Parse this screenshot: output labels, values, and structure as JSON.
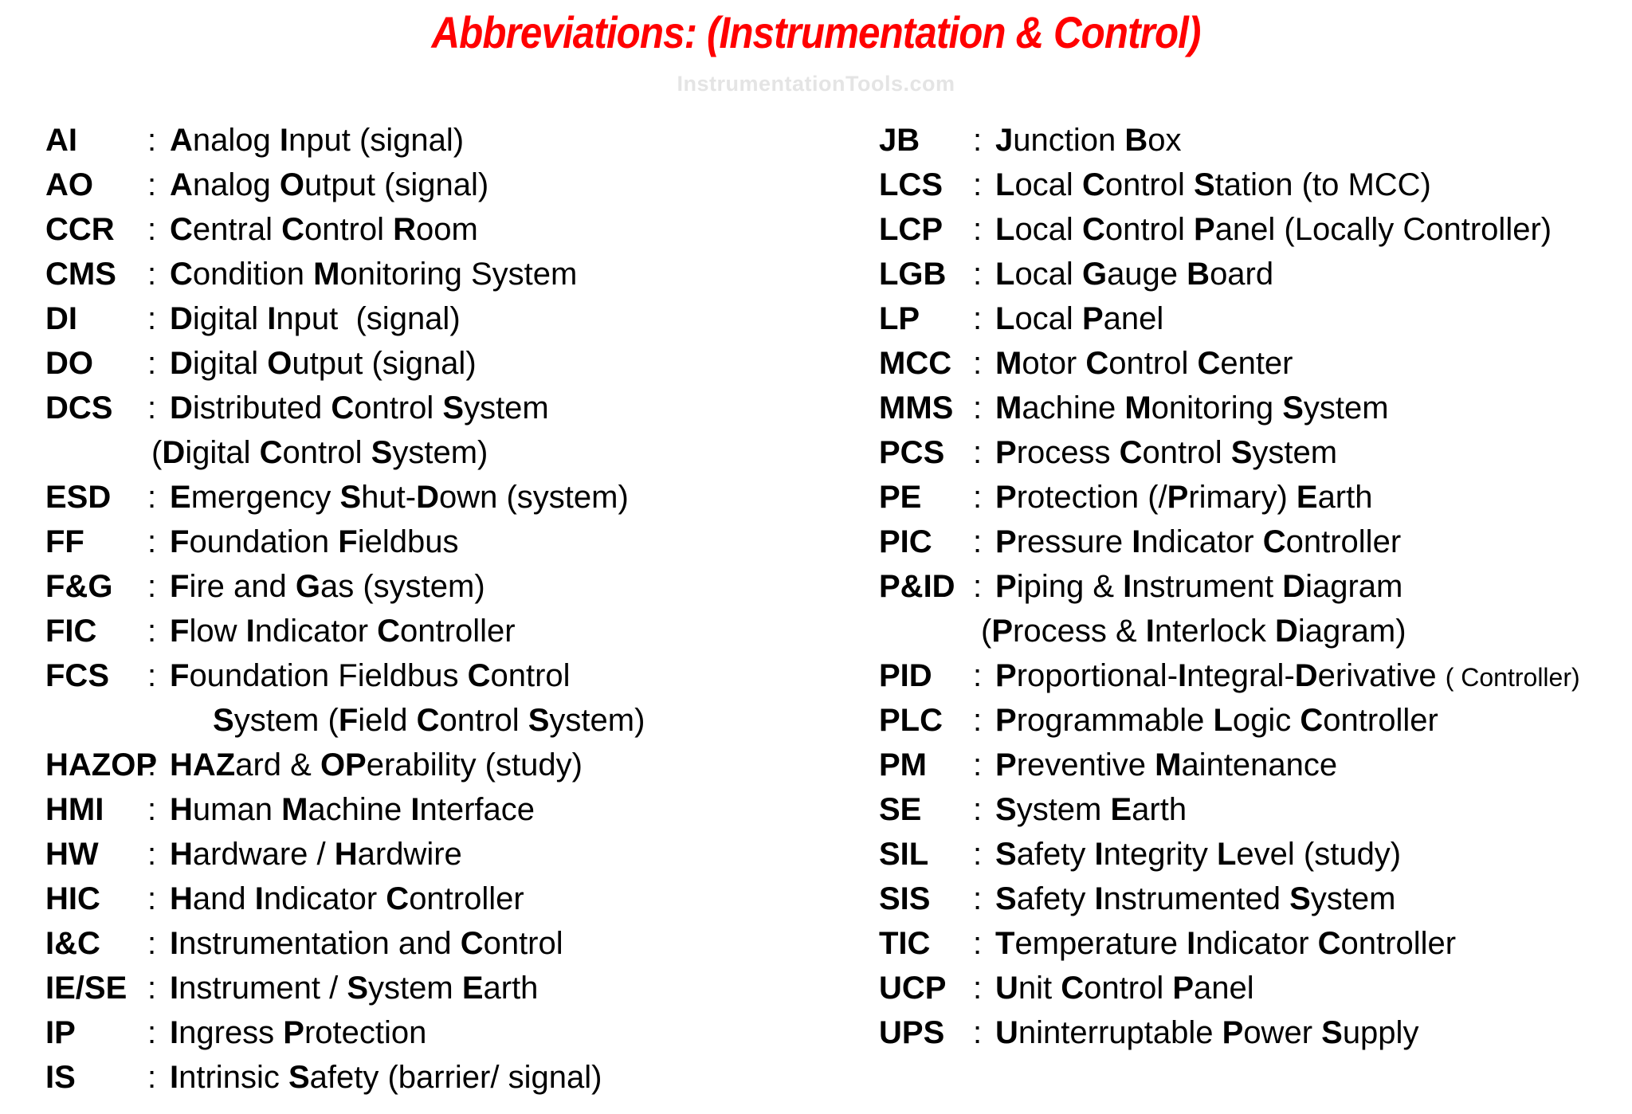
{
  "title": "Abbreviations:  (Instrumentation & Control)",
  "watermark": "InstrumentationTools.com",
  "colors": {
    "title": "#ff0000",
    "watermark": "#e4e4e4",
    "text": "#000000"
  },
  "left": [
    {
      "abbr": "AI",
      "def": [
        [
          "A",
          1
        ],
        [
          "nalog ",
          0
        ],
        [
          "I",
          1
        ],
        [
          "nput (signal)",
          0
        ]
      ]
    },
    {
      "abbr": "AO",
      "def": [
        [
          "A",
          1
        ],
        [
          "nalog ",
          0
        ],
        [
          "O",
          1
        ],
        [
          "utput (signal)",
          0
        ]
      ]
    },
    {
      "abbr": "CCR",
      "def": [
        [
          "C",
          1
        ],
        [
          "entral ",
          0
        ],
        [
          "C",
          1
        ],
        [
          "ontrol ",
          0
        ],
        [
          "R",
          1
        ],
        [
          "oom",
          0
        ]
      ]
    },
    {
      "abbr": "CMS",
      "def": [
        [
          "C",
          1
        ],
        [
          "ondition ",
          0
        ],
        [
          "M",
          1
        ],
        [
          "onitoring System",
          0
        ]
      ]
    },
    {
      "abbr": "DI",
      "def": [
        [
          "D",
          1
        ],
        [
          "igital ",
          0
        ],
        [
          "I",
          1
        ],
        [
          "nput  (signal)",
          0
        ]
      ]
    },
    {
      "abbr": "DO",
      "def": [
        [
          "D",
          1
        ],
        [
          "igital ",
          0
        ],
        [
          "O",
          1
        ],
        [
          "utput (signal)",
          0
        ]
      ]
    },
    {
      "abbr": "DCS",
      "def": [
        [
          "D",
          1
        ],
        [
          "istributed ",
          0
        ],
        [
          "C",
          1
        ],
        [
          "ontrol ",
          0
        ],
        [
          "S",
          1
        ],
        [
          "ystem",
          0
        ]
      ]
    },
    {
      "abbr": "",
      "cont": 1,
      "def": [
        [
          "(",
          0
        ],
        [
          "D",
          1
        ],
        [
          "igital ",
          0
        ],
        [
          "C",
          1
        ],
        [
          "ontrol ",
          0
        ],
        [
          "S",
          1
        ],
        [
          "ystem)",
          0
        ]
      ]
    },
    {
      "abbr": "ESD",
      "def": [
        [
          "E",
          1
        ],
        [
          "mergency ",
          0
        ],
        [
          "S",
          1
        ],
        [
          "hut-",
          0
        ],
        [
          "D",
          1
        ],
        [
          "own (system)",
          0
        ]
      ]
    },
    {
      "abbr": "FF",
      "def": [
        [
          "F",
          1
        ],
        [
          "oundation ",
          0
        ],
        [
          "F",
          1
        ],
        [
          "ieldbus",
          0
        ]
      ]
    },
    {
      "abbr": "F&G",
      "def": [
        [
          "F",
          1
        ],
        [
          "ire and ",
          0
        ],
        [
          "G",
          1
        ],
        [
          "as (system)",
          0
        ]
      ]
    },
    {
      "abbr": "FIC",
      "def": [
        [
          "F",
          1
        ],
        [
          "low ",
          0
        ],
        [
          "I",
          1
        ],
        [
          "ndicator ",
          0
        ],
        [
          "C",
          1
        ],
        [
          "ontroller",
          0
        ]
      ]
    },
    {
      "abbr": "FCS",
      "def": [
        [
          "F",
          1
        ],
        [
          "oundation Fieldbus ",
          0
        ],
        [
          "C",
          1
        ],
        [
          "ontrol",
          0
        ]
      ]
    },
    {
      "abbr": "",
      "cont": 2,
      "def": [
        [
          "S",
          1
        ],
        [
          "ystem (",
          0
        ],
        [
          "F",
          1
        ],
        [
          "ield ",
          0
        ],
        [
          "C",
          1
        ],
        [
          "ontrol ",
          0
        ],
        [
          "S",
          1
        ],
        [
          "ystem)",
          0
        ]
      ]
    },
    {
      "abbr": "HAZOP",
      "def": [
        [
          "HAZ",
          1
        ],
        [
          "ard & ",
          0
        ],
        [
          "OP",
          1
        ],
        [
          "erability (study)",
          0
        ]
      ]
    },
    {
      "abbr": "HMI",
      "def": [
        [
          "H",
          1
        ],
        [
          "uman ",
          0
        ],
        [
          "M",
          1
        ],
        [
          "achine ",
          0
        ],
        [
          "I",
          1
        ],
        [
          "nterface",
          0
        ]
      ]
    },
    {
      "abbr": "HW",
      "def": [
        [
          "H",
          1
        ],
        [
          "ardware / ",
          0
        ],
        [
          "H",
          1
        ],
        [
          "ardwire",
          0
        ]
      ]
    },
    {
      "abbr": "HIC",
      "def": [
        [
          "H",
          1
        ],
        [
          "and ",
          0
        ],
        [
          "I",
          1
        ],
        [
          "ndicator ",
          0
        ],
        [
          "C",
          1
        ],
        [
          "ontroller",
          0
        ]
      ]
    },
    {
      "abbr": "I&C",
      "def": [
        [
          "I",
          1
        ],
        [
          "nstrumentation and ",
          0
        ],
        [
          "C",
          1
        ],
        [
          "ontrol",
          0
        ]
      ]
    },
    {
      "abbr": "IE/SE",
      "def": [
        [
          "I",
          1
        ],
        [
          "nstrument / ",
          0
        ],
        [
          "S",
          1
        ],
        [
          "ystem ",
          0
        ],
        [
          "E",
          1
        ],
        [
          "arth",
          0
        ]
      ]
    },
    {
      "abbr": "IP",
      "def": [
        [
          "I",
          1
        ],
        [
          "ngress ",
          0
        ],
        [
          "P",
          1
        ],
        [
          "rotection",
          0
        ]
      ]
    },
    {
      "abbr": "IS",
      "def": [
        [
          "I",
          1
        ],
        [
          "ntrinsic ",
          0
        ],
        [
          "S",
          1
        ],
        [
          "afety (barrier/ signal)",
          0
        ]
      ]
    }
  ],
  "right": [
    {
      "abbr": "JB",
      "def": [
        [
          "J",
          1
        ],
        [
          "unction ",
          0
        ],
        [
          "B",
          1
        ],
        [
          "ox",
          0
        ]
      ]
    },
    {
      "abbr": "LCS",
      "def": [
        [
          "L",
          1
        ],
        [
          "ocal ",
          0
        ],
        [
          "C",
          1
        ],
        [
          "ontrol ",
          0
        ],
        [
          "S",
          1
        ],
        [
          "tation (to MCC)",
          0
        ]
      ]
    },
    {
      "abbr": "LCP",
      "def": [
        [
          "L",
          1
        ],
        [
          "ocal ",
          0
        ],
        [
          "C",
          1
        ],
        [
          "ontrol ",
          0
        ],
        [
          "P",
          1
        ],
        [
          "anel (Locally Controller)",
          0
        ]
      ]
    },
    {
      "abbr": "LGB",
      "def": [
        [
          "L",
          1
        ],
        [
          "ocal ",
          0
        ],
        [
          "G",
          1
        ],
        [
          "auge ",
          0
        ],
        [
          "B",
          1
        ],
        [
          "oard",
          0
        ]
      ]
    },
    {
      "abbr": "LP",
      "def": [
        [
          "L",
          1
        ],
        [
          "ocal ",
          0
        ],
        [
          "P",
          1
        ],
        [
          "anel",
          0
        ]
      ]
    },
    {
      "abbr": "MCC",
      "def": [
        [
          "M",
          1
        ],
        [
          "otor ",
          0
        ],
        [
          "C",
          1
        ],
        [
          "ontrol ",
          0
        ],
        [
          "C",
          1
        ],
        [
          "enter",
          0
        ]
      ]
    },
    {
      "abbr": "MMS",
      "def": [
        [
          "M",
          1
        ],
        [
          "achine ",
          0
        ],
        [
          "M",
          1
        ],
        [
          "onitoring ",
          0
        ],
        [
          "S",
          1
        ],
        [
          "ystem",
          0
        ]
      ]
    },
    {
      "abbr": "PCS",
      "def": [
        [
          "P",
          1
        ],
        [
          "rocess ",
          0
        ],
        [
          "C",
          1
        ],
        [
          "ontrol ",
          0
        ],
        [
          "S",
          1
        ],
        [
          "ystem",
          0
        ]
      ]
    },
    {
      "abbr": "PE",
      "def": [
        [
          "P",
          1
        ],
        [
          "rotection (/",
          0
        ],
        [
          "P",
          1
        ],
        [
          "rimary) ",
          0
        ],
        [
          "E",
          1
        ],
        [
          "arth",
          0
        ]
      ]
    },
    {
      "abbr": "PIC",
      "def": [
        [
          "P",
          1
        ],
        [
          "ressure ",
          0
        ],
        [
          "I",
          1
        ],
        [
          "ndicator ",
          0
        ],
        [
          "C",
          1
        ],
        [
          "ontroller",
          0
        ]
      ]
    },
    {
      "abbr": "P&ID",
      "def": [
        [
          "P",
          1
        ],
        [
          "iping & ",
          0
        ],
        [
          "I",
          1
        ],
        [
          "nstrument ",
          0
        ],
        [
          "D",
          1
        ],
        [
          "iagram",
          0
        ]
      ]
    },
    {
      "abbr": "",
      "cont": 1,
      "def": [
        [
          "(",
          0
        ],
        [
          "P",
          1
        ],
        [
          "rocess & ",
          0
        ],
        [
          "I",
          1
        ],
        [
          "nterlock ",
          0
        ],
        [
          "D",
          1
        ],
        [
          "iagram)",
          0
        ]
      ]
    },
    {
      "abbr": "PID",
      "def": [
        [
          "P",
          1
        ],
        [
          "roportional-",
          0
        ],
        [
          "I",
          1
        ],
        [
          "ntegral-",
          0
        ],
        [
          "D",
          1
        ],
        [
          "erivative ",
          0
        ],
        [
          "( Controller)",
          2
        ]
      ]
    },
    {
      "abbr": "PLC",
      "def": [
        [
          "P",
          1
        ],
        [
          "rogrammable ",
          0
        ],
        [
          "L",
          1
        ],
        [
          "ogic ",
          0
        ],
        [
          "C",
          1
        ],
        [
          "ontroller",
          0
        ]
      ]
    },
    {
      "abbr": "PM",
      "def": [
        [
          "P",
          1
        ],
        [
          "reventive ",
          0
        ],
        [
          "M",
          1
        ],
        [
          "aintenance",
          0
        ]
      ]
    },
    {
      "abbr": "SE",
      "def": [
        [
          "S",
          1
        ],
        [
          "ystem ",
          0
        ],
        [
          "E",
          1
        ],
        [
          "arth",
          0
        ]
      ]
    },
    {
      "abbr": "SIL",
      "def": [
        [
          "S",
          1
        ],
        [
          "afety ",
          0
        ],
        [
          "I",
          1
        ],
        [
          "ntegrity ",
          0
        ],
        [
          "L",
          1
        ],
        [
          "evel (study)",
          0
        ]
      ]
    },
    {
      "abbr": "SIS",
      "def": [
        [
          "S",
          1
        ],
        [
          "afety ",
          0
        ],
        [
          "I",
          1
        ],
        [
          "nstrumented ",
          0
        ],
        [
          "S",
          1
        ],
        [
          "ystem",
          0
        ]
      ]
    },
    {
      "abbr": "TIC",
      "def": [
        [
          "T",
          1
        ],
        [
          "emperature ",
          0
        ],
        [
          "I",
          1
        ],
        [
          "ndicator ",
          0
        ],
        [
          "C",
          1
        ],
        [
          "ontroller",
          0
        ]
      ]
    },
    {
      "abbr": "UCP",
      "def": [
        [
          "U",
          1
        ],
        [
          "nit ",
          0
        ],
        [
          "C",
          1
        ],
        [
          "ontrol ",
          0
        ],
        [
          "P",
          1
        ],
        [
          "anel",
          0
        ]
      ]
    },
    {
      "abbr": "UPS",
      "def": [
        [
          "U",
          1
        ],
        [
          "ninterruptable ",
          0
        ],
        [
          "P",
          1
        ],
        [
          "ower ",
          0
        ],
        [
          "S",
          1
        ],
        [
          "upply",
          0
        ]
      ]
    }
  ],
  "separator": ":"
}
